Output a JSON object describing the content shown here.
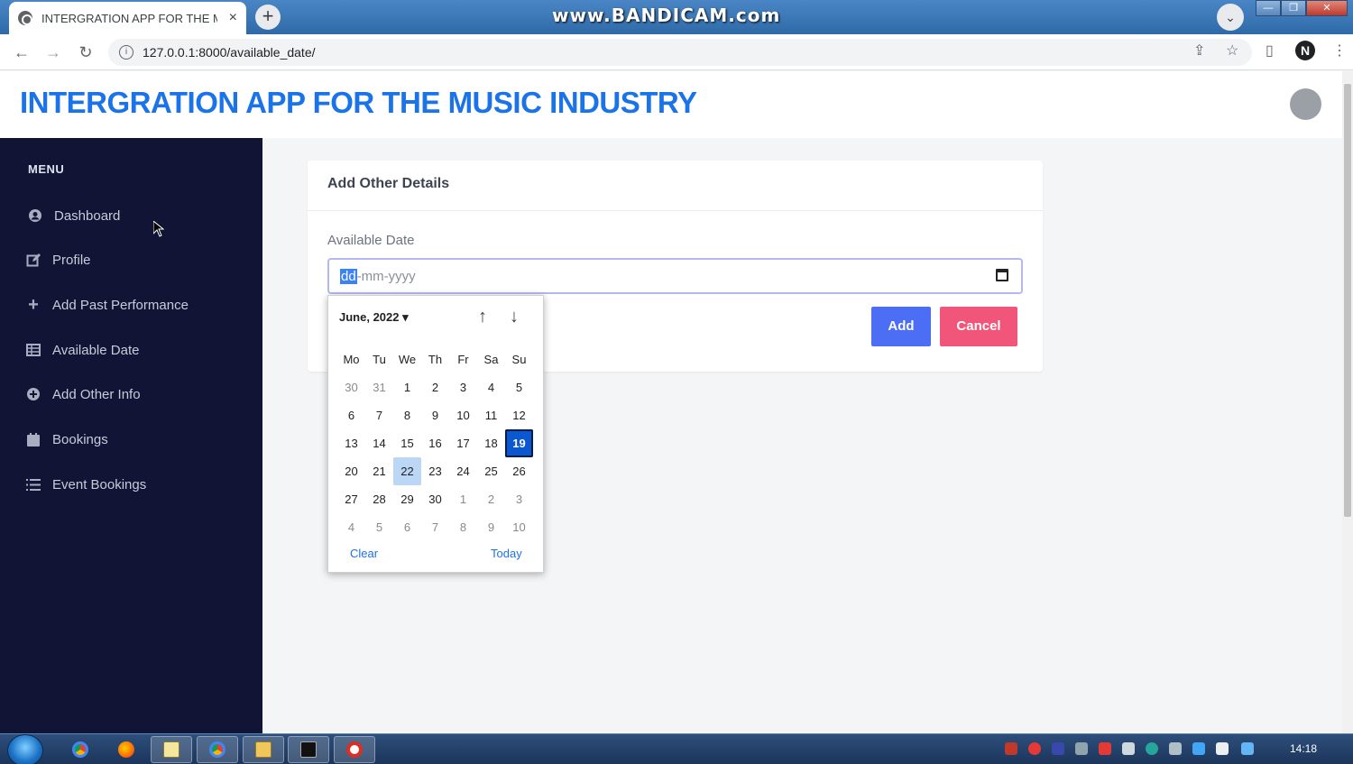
{
  "browser": {
    "tab_title": "INTERGRATION APP FOR THE MUSIC INDUSTRY",
    "tab_close": "×",
    "new_tab": "+",
    "watermark": "www.BANDICAM.com",
    "url": "127.0.0.1:8000/available_date/",
    "profile_initial": "N"
  },
  "app": {
    "title": "INTERGRATION APP FOR THE MUSIC INDUSTRY"
  },
  "sidebar": {
    "heading": "MENU",
    "items": [
      {
        "label": "Dashboard",
        "icon": "user-circle-icon"
      },
      {
        "label": "Profile",
        "icon": "edit-icon"
      },
      {
        "label": "Add Past Performance",
        "icon": "plus-icon"
      },
      {
        "label": "Available Date",
        "icon": "table-icon"
      },
      {
        "label": "Add Other Info",
        "icon": "plus-circle-icon"
      },
      {
        "label": "Bookings",
        "icon": "calendar-icon"
      },
      {
        "label": "Event Bookings",
        "icon": "list-icon"
      }
    ]
  },
  "form": {
    "card_title": "Add Other Details",
    "field_label": "Available Date",
    "input_dd": "dd",
    "input_rest": "-mm-yyyy",
    "add_label": "Add",
    "cancel_label": "Cancel"
  },
  "datepicker": {
    "month_label": "June, 2022 ▾",
    "weekdays": [
      "Mo",
      "Tu",
      "We",
      "Th",
      "Fr",
      "Sa",
      "Su"
    ],
    "weeks": [
      [
        "30",
        "31",
        "1",
        "2",
        "3",
        "4",
        "5"
      ],
      [
        "6",
        "7",
        "8",
        "9",
        "10",
        "11",
        "12"
      ],
      [
        "13",
        "14",
        "15",
        "16",
        "17",
        "18",
        "19"
      ],
      [
        "20",
        "21",
        "22",
        "23",
        "24",
        "25",
        "26"
      ],
      [
        "27",
        "28",
        "29",
        "30",
        "1",
        "2",
        "3"
      ],
      [
        "4",
        "5",
        "6",
        "7",
        "8",
        "9",
        "10"
      ]
    ],
    "selected_day": "19",
    "hovered_day": "22",
    "clear_label": "Clear",
    "today_label": "Today"
  },
  "taskbar": {
    "clock": "14:18"
  }
}
